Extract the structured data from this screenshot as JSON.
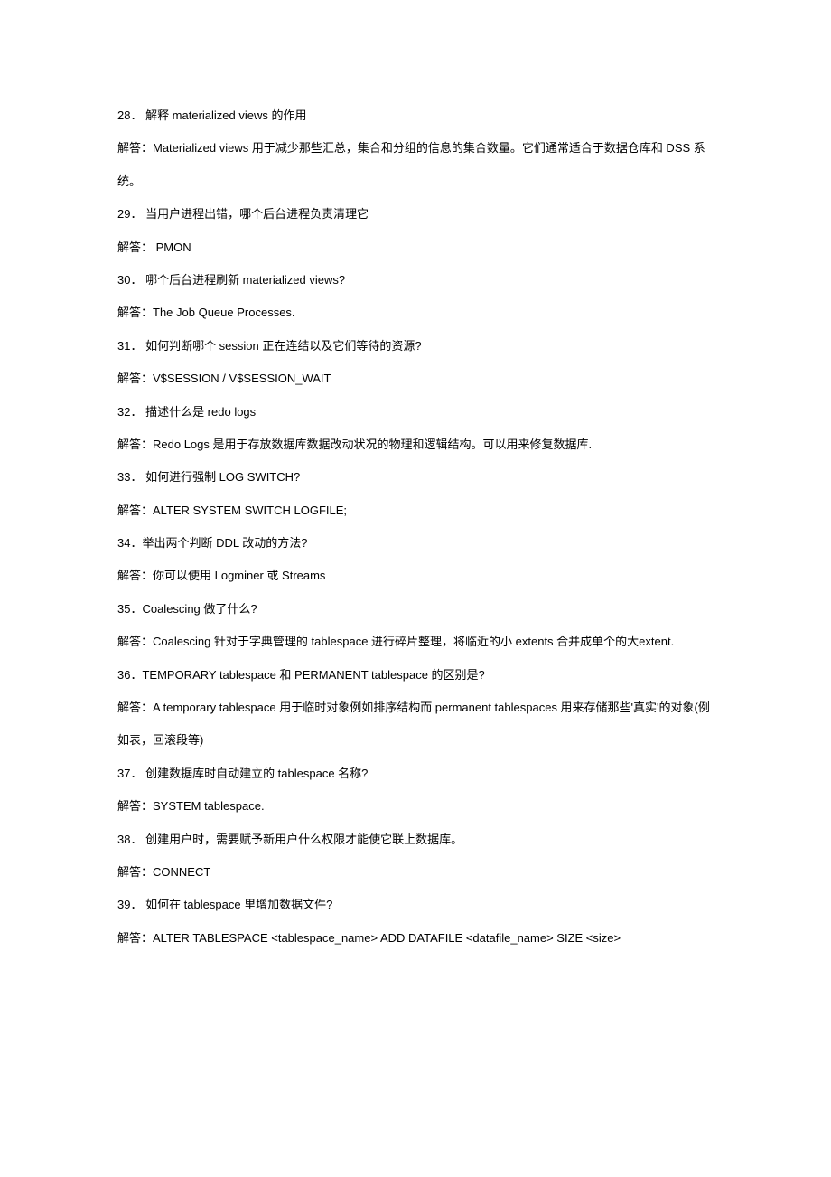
{
  "items": [
    "28． 解释 materialized views 的作用",
    "解答：Materialized views 用于减少那些汇总，集合和分组的信息的集合数量。它们通常适合于数据仓库和 DSS 系统。",
    "29． 当用户进程出错，哪个后台进程负责清理它",
    "解答： PMON",
    "30． 哪个后台进程刷新 materialized views?",
    "解答：The Job Queue Processes.",
    "31． 如何判断哪个 session 正在连结以及它们等待的资源?",
    "解答：V$SESSION / V$SESSION_WAIT",
    "32． 描述什么是 redo logs",
    "解答：Redo Logs 是用于存放数据库数据改动状况的物理和逻辑结构。可以用来修复数据库.",
    "33． 如何进行强制 LOG SWITCH?",
    "解答：ALTER SYSTEM SWITCH LOGFILE;",
    "34．举出两个判断 DDL 改动的方法?",
    "解答：你可以使用 Logminer 或 Streams",
    "35．Coalescing 做了什么?",
    "解答：Coalescing 针对于字典管理的 tablespace 进行碎片整理，将临近的小 extents 合并成单个的大extent.",
    "36．TEMPORARY tablespace 和 PERMANENT tablespace 的区别是?",
    "解答：A temporary tablespace 用于临时对象例如排序结构而 permanent tablespaces 用来存储那些'真实'的对象(例如表，回滚段等)",
    "37． 创建数据库时自动建立的 tablespace 名称?",
    "解答：SYSTEM tablespace.",
    "38． 创建用户时，需要赋予新用户什么权限才能使它联上数据库。",
    "解答：CONNECT",
    "39． 如何在 tablespace 里增加数据文件?",
    "解答：ALTER TABLESPACE <tablespace_name> ADD DATAFILE <datafile_name> SIZE <size>"
  ]
}
